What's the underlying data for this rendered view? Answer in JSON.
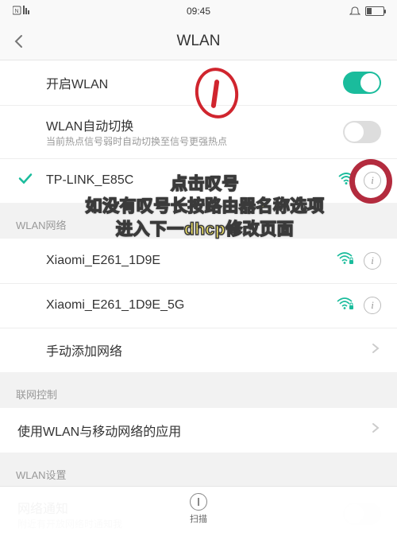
{
  "status": {
    "time": "09:45"
  },
  "header": {
    "title": "WLAN"
  },
  "wlan": {
    "enable_label": "开启WLAN",
    "auto_switch_label": "WLAN自动切换",
    "auto_switch_sub": "当前热点信号弱时自动切换至信号更强热点",
    "connected": {
      "ssid": "TP-LINK_E85C"
    }
  },
  "sections": {
    "networks": "WLAN网络",
    "network_control": "联网控制",
    "wlan_settings": "WLAN设置"
  },
  "networks": [
    {
      "ssid": "Xiaomi_E261_1D9E"
    },
    {
      "ssid": "Xiaomi_E261_1D9E_5G"
    }
  ],
  "manual_add": "手动添加网络",
  "apps_control": "使用WLAN与移动网络的应用",
  "net_notify": {
    "label": "网络通知",
    "sub": "附近有开放网络时通知我"
  },
  "tab": {
    "scan": "扫描"
  },
  "annotation": {
    "line1": "点击叹号",
    "line2": "如没有叹号长按路由器名称选项",
    "line3": "进入下一dhcp修改页面"
  }
}
